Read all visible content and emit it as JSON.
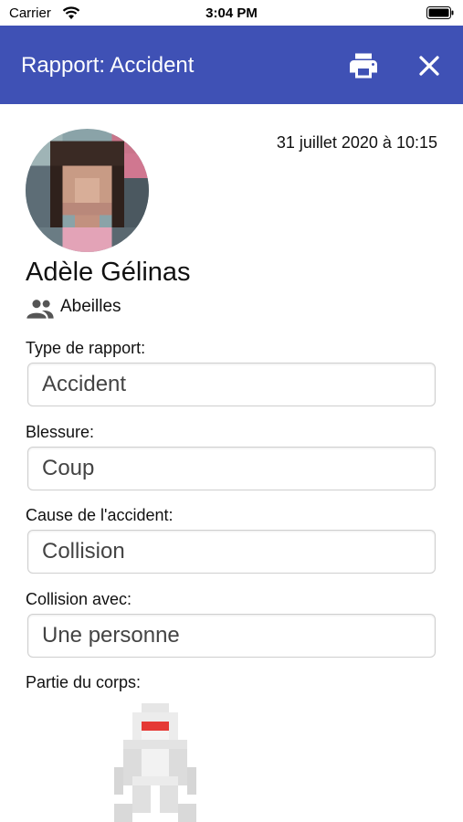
{
  "status_bar": {
    "carrier": "Carrier",
    "time": "3:04 PM"
  },
  "app_bar": {
    "title": "Rapport: Accident",
    "color": "#3f51b5",
    "icons": [
      "printer-icon",
      "close-icon"
    ]
  },
  "report": {
    "date": "31 juillet 2020 à 10:15",
    "person": {
      "name": "Adèle Gélinas",
      "group": "Abeilles"
    },
    "fields": [
      {
        "label": "Type de rapport:",
        "value": "Accident"
      },
      {
        "label": "Blessure:",
        "value": "Coup"
      },
      {
        "label": "Cause de l'accident:",
        "value": "Collision"
      },
      {
        "label": "Collision avec:",
        "value": "Une personne"
      }
    ],
    "body_part_label": "Partie du corps:",
    "highlight_color": "#e53935"
  }
}
